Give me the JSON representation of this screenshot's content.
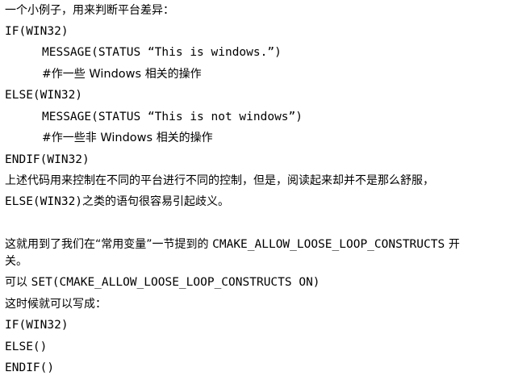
{
  "lines": [
    "一个小例子，用来判断平台差异：",
    "IF(WIN32)",
    "MESSAGE(STATUS “This is windows.”)",
    "#作一些",
    "Windows",
    "相关的操作",
    "ELSE(WIN32)",
    "MESSAGE(STATUS “This is not windows”)",
    "#作一些非",
    "Windows",
    "相关的操作",
    "ENDIF(WIN32)",
    "上述代码用来控制在不同的平台进行不同的控制，但是，阅读起来却并不是那么舒服，",
    "ELSE(WIN32)",
    "之类的语句很容易引起歧义。",
    "这就用到了我们在“常用变量”一节提到的",
    "CMAKE_ALLOW_LOOSE_LOOP_CONSTRUCTS",
    "开",
    "关。",
    "可以",
    "SET(CMAKE_ALLOW_LOOSE_LOOP_CONSTRUCTS ON)",
    "这时候就可以写成：",
    "IF(WIN32)",
    "ELSE()",
    "ENDIF()"
  ]
}
